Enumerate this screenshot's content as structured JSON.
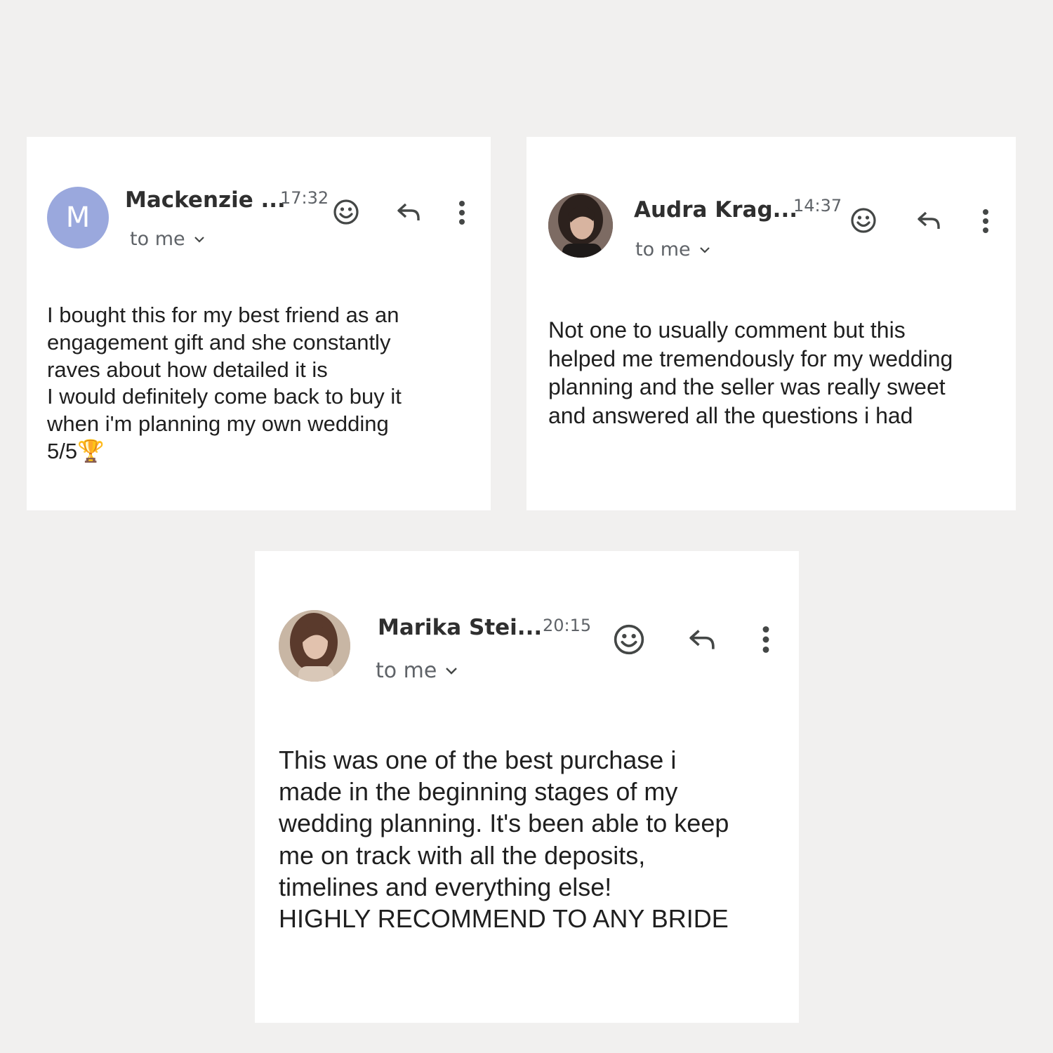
{
  "reviews": [
    {
      "sender": "Mackenzie ...",
      "time": "17:32",
      "recipient": "to me",
      "avatar_letter": "M",
      "avatar_color": "#9aa8dd",
      "body": "I bought this for my best friend as an\nengagement gift and she constantly\nraves about how detailed it is\nI would definitely come back to buy it\nwhen i'm planning my own wedding\n5/5🏆"
    },
    {
      "sender": "Audra Krag...",
      "time": "14:37",
      "recipient": "to me",
      "avatar_type": "photo",
      "body": "Not one to usually comment but this\nhelped me tremendously for my wedding\nplanning and the seller was really sweet\nand answered all the questions i had"
    },
    {
      "sender": "Marika Stei...",
      "time": "20:15",
      "recipient": "to me",
      "avatar_type": "photo",
      "body": "This was one of the best purchase i\nmade in the beginning stages of my\nwedding planning. It's been able to keep\nme on track with all the deposits,\ntimelines and everything else!\n HIGHLY RECOMMEND TO ANY BRIDE"
    }
  ],
  "icons": [
    "emoji-react-icon",
    "reply-icon",
    "more-options-icon",
    "chevron-down-icon"
  ],
  "colors": {
    "background": "#f1f0ef",
    "card": "#ffffff",
    "icon": "#444746",
    "muted_text": "#5f6368"
  }
}
